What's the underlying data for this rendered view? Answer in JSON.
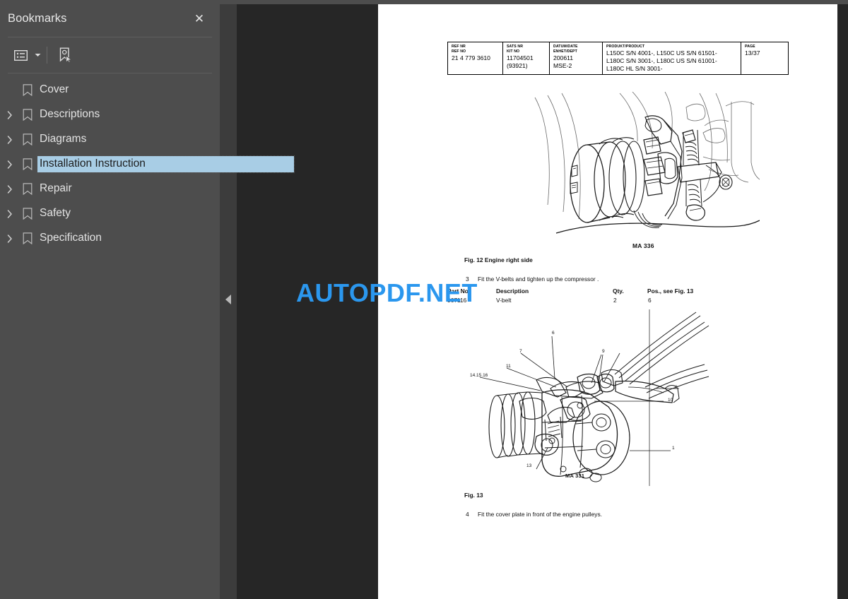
{
  "window": {
    "app": "PDF Viewer"
  },
  "sidebar": {
    "title": "Bookmarks",
    "close_label": "✕",
    "toolbar": {
      "options_icon": "list-options-icon",
      "caret_icon": "chevron-down-icon",
      "select_bookmark_icon": "bookmark-pointer-icon"
    },
    "items": [
      {
        "label": "Cover",
        "expandable": false,
        "selected": false
      },
      {
        "label": "Descriptions",
        "expandable": true,
        "selected": false
      },
      {
        "label": "Diagrams",
        "expandable": true,
        "selected": false
      },
      {
        "label": "Installation Instruction",
        "expandable": true,
        "selected": true
      },
      {
        "label": "Repair",
        "expandable": true,
        "selected": false
      },
      {
        "label": "Safety",
        "expandable": true,
        "selected": false
      },
      {
        "label": "Specification",
        "expandable": true,
        "selected": false
      }
    ]
  },
  "splitter": {
    "collapse_icon": "triangle-left-icon"
  },
  "watermark": {
    "text": "AUTOPDF.NET",
    "color": "#2b97ee"
  },
  "page": {
    "header_table": {
      "columns": [
        {
          "labels": [
            "REF NR",
            "REF NO"
          ],
          "values": [
            "21 4 779 3610"
          ]
        },
        {
          "labels": [
            "SATS NR",
            "KIT NO"
          ],
          "values": [
            "11704501",
            "(93921)"
          ]
        },
        {
          "labels": [
            "DATUM/DATE",
            "ENHET/DEPT"
          ],
          "values": [
            "200611",
            "MSE-2"
          ]
        },
        {
          "labels": [
            "PRODUKT/PRODUCT"
          ],
          "values": [
            "L150C S/N 4001-, L150C US S/N 61501-",
            "L180C S/N 3001-, L180C US S/N 61001-",
            "L180C HL S/N 3001-"
          ]
        },
        {
          "labels": [
            "PAGE"
          ],
          "values": [
            "13/37"
          ]
        }
      ]
    },
    "figure_12": {
      "code": "MA 336",
      "caption": "Fig. 12  Engine right side"
    },
    "step_3": {
      "number": "3",
      "text": "Fit the V-belts and tighten up the compressor ."
    },
    "parts_table": {
      "headers": [
        "Part No.",
        "Description",
        "Qty.",
        "Pos., see Fig. 13"
      ],
      "rows": [
        [
          "967116",
          "V-belt",
          "2",
          "6"
        ]
      ]
    },
    "figure_13": {
      "code": "MA 331",
      "caption": "Fig. 13",
      "callouts": [
        "1",
        "6",
        "7",
        "8",
        "9",
        "10",
        "11",
        "13",
        "14.15.16"
      ]
    },
    "step_4": {
      "number": "4",
      "text": "Fit the cover plate in front of the engine pulleys."
    }
  }
}
